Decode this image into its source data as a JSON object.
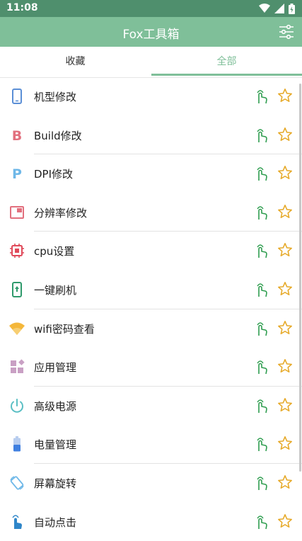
{
  "status_bar": {
    "time": "11:08"
  },
  "app_bar": {
    "title": "Fox工具箱"
  },
  "tabs": [
    {
      "label": "收藏",
      "active": false
    },
    {
      "label": "全部",
      "active": true
    }
  ],
  "accent_color": "#7fbf99",
  "items": [
    {
      "label": "机型修改",
      "icon": "phone-icon"
    },
    {
      "label": "Build修改",
      "icon": "letter-b-icon"
    },
    {
      "label": "DPI修改",
      "icon": "letter-p-icon"
    },
    {
      "label": "分辨率修改",
      "icon": "resolution-icon"
    },
    {
      "label": "cpu设置",
      "icon": "cpu-chip-icon"
    },
    {
      "label": "一键刷机",
      "icon": "flash-phone-icon"
    },
    {
      "label": "wifi密码查看",
      "icon": "wifi-icon"
    },
    {
      "label": "应用管理",
      "icon": "apps-icon"
    },
    {
      "label": "高级电源",
      "icon": "power-icon"
    },
    {
      "label": "电量管理",
      "icon": "battery-icon"
    },
    {
      "label": "屏幕旋转",
      "icon": "rotate-screen-icon"
    },
    {
      "label": "自动点击",
      "icon": "auto-click-icon"
    }
  ]
}
